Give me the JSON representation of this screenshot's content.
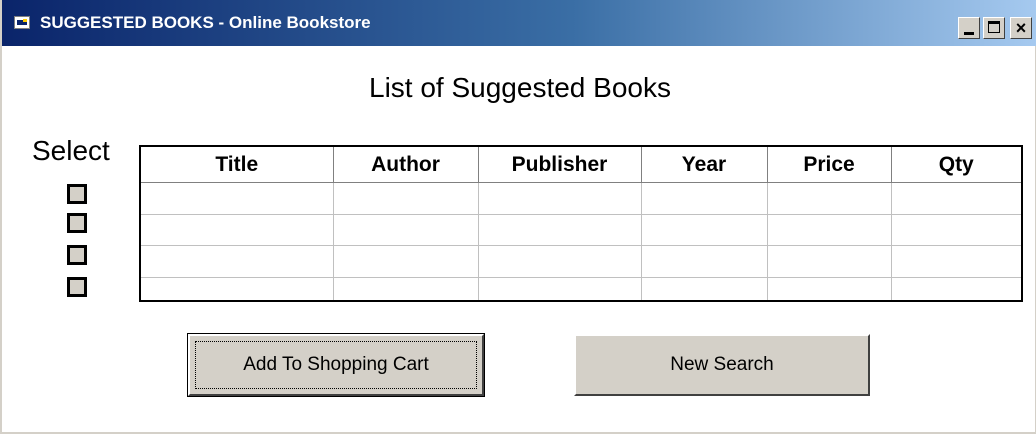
{
  "window": {
    "title": "SUGGESTED BOOKS - Online Bookstore",
    "controls": {
      "minimize": "_",
      "maximize": "□",
      "close": "×"
    }
  },
  "main": {
    "heading": "List of Suggested Books",
    "select_label": "Select",
    "table": {
      "columns": [
        "Title",
        "Author",
        "Publisher",
        "Year",
        "Price",
        "Qty"
      ],
      "rows": [
        [
          "",
          "",
          "",
          "",
          "",
          ""
        ],
        [
          "",
          "",
          "",
          "",
          "",
          ""
        ],
        [
          "",
          "",
          "",
          "",
          "",
          ""
        ],
        [
          "",
          "",
          "",
          "",
          "",
          ""
        ]
      ]
    },
    "checkboxes": [
      {
        "checked": false
      },
      {
        "checked": false
      },
      {
        "checked": false
      },
      {
        "checked": false
      }
    ]
  },
  "buttons": {
    "add_to_cart": "Add To Shopping Cart",
    "new_search": "New Search"
  }
}
